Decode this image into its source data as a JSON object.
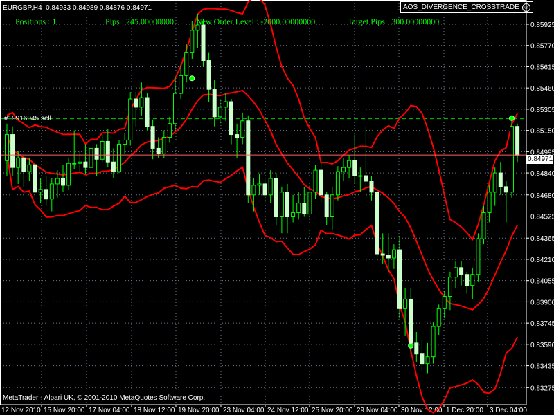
{
  "header": {
    "symbol": "EURGBP,H4",
    "ohlc": "0.84933 0.84989 0.84876 0.84971",
    "expert": "AOS_DIVERGENCE_CROSSTRADE",
    "expert_icon": "smiley-icon"
  },
  "stats": {
    "positions": "Positions : 1",
    "pips": "Pips : 245.00000000",
    "new_order": "New Order Level : -2000.00000000",
    "target": "Target Pips : 300.00000000"
  },
  "order_label": "#19916045 sell",
  "copyright": "MetaTrader - Alpari UK, © 2001-2010 MetaQuotes Software Corp.",
  "current_price": "0.84971",
  "colors": {
    "background": "#000000",
    "candle_up": "#000000",
    "candle_down": "#ccffcc",
    "wick": "#00ff00",
    "bands": "#ff0000",
    "grid": "#6c7a8c",
    "stats_text": "#00ff00",
    "price_line": "#ff5f5f"
  },
  "chart_data": {
    "type": "candlestick",
    "y_ticks": [
      "0.85925",
      "0.85770",
      "0.85615",
      "0.85460",
      "0.85305",
      "0.85150",
      "0.84995",
      "0.84840",
      "0.84680",
      "0.84525",
      "0.84365",
      "0.84210",
      "0.84055",
      "0.83900",
      "0.83745",
      "0.83590",
      "0.83435",
      "0.83275"
    ],
    "ylim": [
      0.83275,
      0.86
    ],
    "x_labels": [
      "12 Nov 2010",
      "15 Nov 20:00",
      "17 Nov 04:00",
      "18 Nov 12:00",
      "19 Nov 20:00",
      "23 Nov 04:00",
      "24 Nov 12:00",
      "25 Nov 20:00",
      "29 Nov 04:00",
      "30 Nov 12:00",
      "1 Dec 20:00",
      "3 Dec 04:00"
    ],
    "sell_order_level": 0.85236,
    "current_price_value": 0.84971,
    "marker_points": [
      {
        "index": 33,
        "price": 0.8553
      },
      {
        "index": 72,
        "price": 0.8358
      },
      {
        "index": 90,
        "price": 0.8524
      }
    ],
    "candles": [
      [
        0.8493,
        0.852,
        0.8482,
        0.8512
      ],
      [
        0.8512,
        0.8518,
        0.8482,
        0.8488
      ],
      [
        0.8488,
        0.85,
        0.8476,
        0.8495
      ],
      [
        0.8495,
        0.8497,
        0.8474,
        0.8485
      ],
      [
        0.8485,
        0.8495,
        0.8478,
        0.849
      ],
      [
        0.849,
        0.8494,
        0.8465,
        0.847
      ],
      [
        0.847,
        0.848,
        0.8462,
        0.8472
      ],
      [
        0.8472,
        0.8482,
        0.846,
        0.8465
      ],
      [
        0.8465,
        0.848,
        0.8456,
        0.8476
      ],
      [
        0.8476,
        0.8486,
        0.8466,
        0.848
      ],
      [
        0.848,
        0.849,
        0.847,
        0.8475
      ],
      [
        0.8475,
        0.8495,
        0.8472,
        0.8491
      ],
      [
        0.8491,
        0.8515,
        0.8487,
        0.8491
      ],
      [
        0.8491,
        0.85,
        0.8484,
        0.8492
      ],
      [
        0.8492,
        0.8505,
        0.8483,
        0.8488
      ],
      [
        0.8488,
        0.851,
        0.848,
        0.8502
      ],
      [
        0.8502,
        0.8505,
        0.8482,
        0.8494
      ],
      [
        0.8494,
        0.8512,
        0.8492,
        0.8507
      ],
      [
        0.8507,
        0.8516,
        0.8488,
        0.8492
      ],
      [
        0.8492,
        0.8502,
        0.848,
        0.8485
      ],
      [
        0.8485,
        0.8508,
        0.8484,
        0.8505
      ],
      [
        0.8505,
        0.8513,
        0.8498,
        0.8508
      ],
      [
        0.8508,
        0.8543,
        0.8504,
        0.8538
      ],
      [
        0.8538,
        0.8543,
        0.8518,
        0.8532
      ],
      [
        0.8532,
        0.855,
        0.8526,
        0.8539
      ],
      [
        0.8539,
        0.8542,
        0.8515,
        0.8518
      ],
      [
        0.8518,
        0.8523,
        0.8494,
        0.8502
      ],
      [
        0.8502,
        0.851,
        0.8495,
        0.8498
      ],
      [
        0.8498,
        0.8515,
        0.8495,
        0.851
      ],
      [
        0.851,
        0.8525,
        0.8506,
        0.852
      ],
      [
        0.852,
        0.8554,
        0.8515,
        0.8542
      ],
      [
        0.8542,
        0.8563,
        0.8538,
        0.8555
      ],
      [
        0.8555,
        0.8578,
        0.855,
        0.8572
      ],
      [
        0.8572,
        0.8595,
        0.8567,
        0.8588
      ],
      [
        0.8588,
        0.86,
        0.8575,
        0.8592
      ],
      [
        0.8592,
        0.8596,
        0.8562,
        0.8566
      ],
      [
        0.8566,
        0.8572,
        0.8536,
        0.8545
      ],
      [
        0.8545,
        0.8552,
        0.8518,
        0.8525
      ],
      [
        0.8525,
        0.8538,
        0.852,
        0.8532
      ],
      [
        0.8532,
        0.8542,
        0.8522,
        0.8536
      ],
      [
        0.8536,
        0.8538,
        0.8505,
        0.8512
      ],
      [
        0.8512,
        0.852,
        0.8495,
        0.851
      ],
      [
        0.851,
        0.8528,
        0.8505,
        0.8522
      ],
      [
        0.8522,
        0.8526,
        0.8462,
        0.8468
      ],
      [
        0.8468,
        0.848,
        0.8456,
        0.8475
      ],
      [
        0.8475,
        0.8483,
        0.8468,
        0.8476
      ],
      [
        0.8476,
        0.848,
        0.8462,
        0.8468
      ],
      [
        0.8468,
        0.8486,
        0.8462,
        0.848
      ],
      [
        0.848,
        0.8484,
        0.8446,
        0.8452
      ],
      [
        0.8452,
        0.8474,
        0.844,
        0.847
      ],
      [
        0.847,
        0.8476,
        0.844,
        0.8452
      ],
      [
        0.8452,
        0.8468,
        0.8448,
        0.8455
      ],
      [
        0.8455,
        0.847,
        0.845,
        0.8462
      ],
      [
        0.8462,
        0.8474,
        0.8452,
        0.8454
      ],
      [
        0.8454,
        0.8475,
        0.845,
        0.847
      ],
      [
        0.847,
        0.849,
        0.8465,
        0.8486
      ],
      [
        0.8486,
        0.8492,
        0.8462,
        0.8468
      ],
      [
        0.8468,
        0.847,
        0.8446,
        0.8452
      ],
      [
        0.8452,
        0.8474,
        0.8442,
        0.8468
      ],
      [
        0.8468,
        0.8489,
        0.8464,
        0.8485
      ],
      [
        0.8485,
        0.8495,
        0.8478,
        0.8488
      ],
      [
        0.8488,
        0.8497,
        0.848,
        0.8493
      ],
      [
        0.8493,
        0.8512,
        0.8476,
        0.8482
      ],
      [
        0.8482,
        0.8488,
        0.847,
        0.8482
      ],
      [
        0.8482,
        0.8518,
        0.8475,
        0.8478
      ],
      [
        0.8478,
        0.8482,
        0.8464,
        0.847
      ],
      [
        0.847,
        0.8474,
        0.842,
        0.8425
      ],
      [
        0.8425,
        0.844,
        0.8418,
        0.8424
      ],
      [
        0.8424,
        0.844,
        0.8412,
        0.8422
      ],
      [
        0.8422,
        0.8432,
        0.8414,
        0.8428
      ],
      [
        0.8428,
        0.8438,
        0.8378,
        0.8385
      ],
      [
        0.8385,
        0.84,
        0.8365,
        0.8392
      ],
      [
        0.8392,
        0.84,
        0.8352,
        0.836
      ],
      [
        0.836,
        0.8368,
        0.8346,
        0.8352
      ],
      [
        0.8352,
        0.8362,
        0.834,
        0.8345
      ],
      [
        0.8345,
        0.836,
        0.8338,
        0.835
      ],
      [
        0.835,
        0.8375,
        0.8345,
        0.8372
      ],
      [
        0.8372,
        0.8388,
        0.8366,
        0.8385
      ],
      [
        0.8385,
        0.8398,
        0.8378,
        0.8394
      ],
      [
        0.8394,
        0.8412,
        0.8384,
        0.8408
      ],
      [
        0.8408,
        0.842,
        0.84,
        0.8415
      ],
      [
        0.8415,
        0.842,
        0.8402,
        0.841
      ],
      [
        0.841,
        0.8412,
        0.8396,
        0.8402
      ],
      [
        0.8402,
        0.8415,
        0.8392,
        0.841
      ],
      [
        0.841,
        0.844,
        0.8405,
        0.8436
      ],
      [
        0.8436,
        0.846,
        0.8432,
        0.8455
      ],
      [
        0.8455,
        0.8475,
        0.8448,
        0.847
      ],
      [
        0.847,
        0.8488,
        0.846,
        0.8484
      ],
      [
        0.8484,
        0.8492,
        0.8468,
        0.8474
      ],
      [
        0.8474,
        0.8478,
        0.8448,
        0.847
      ],
      [
        0.847,
        0.8525,
        0.8466,
        0.8518
      ],
      [
        0.8518,
        0.852,
        0.8492,
        0.8497
      ]
    ]
  }
}
